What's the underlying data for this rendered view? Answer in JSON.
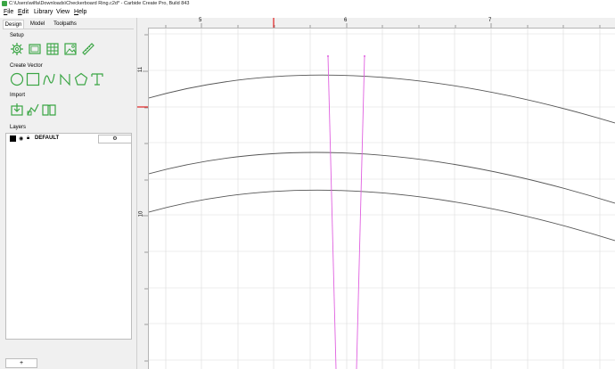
{
  "window": {
    "title": "C:\\Users\\wilfa\\Downloads\\Checkerboard Ring.c2d* - Carbide Create Pro, Build 843"
  },
  "menu": [
    {
      "label": "File",
      "u": "F",
      "rest": "ile"
    },
    {
      "label": "Edit",
      "u": "E",
      "rest": "dit"
    },
    {
      "label": "Library",
      "u": "",
      "rest": "Library"
    },
    {
      "label": "View",
      "u": "",
      "rest": "View"
    },
    {
      "label": "Help",
      "u": "H",
      "rest": "elp"
    }
  ],
  "tabs": [
    "Design",
    "Model",
    "Toolpaths"
  ],
  "active_tab": "Design",
  "sections": {
    "setup": "Setup",
    "create_vector": "Create Vector",
    "import": "Import",
    "layers": "Layers"
  },
  "tool_icons": {
    "setup": [
      "gear-icon",
      "rectangle-icon",
      "grid-icon",
      "image-icon",
      "ruler-icon"
    ],
    "create_vector": [
      "circle-icon",
      "square-icon",
      "curve-icon",
      "polyline-icon",
      "pentagon-icon",
      "text-icon"
    ],
    "import": [
      "import-icon",
      "import-svg-icon",
      "library-book-icon"
    ]
  },
  "layers": [
    {
      "name": "DEFAULT",
      "color": "#000000"
    }
  ],
  "add_layer_label": "+",
  "ruler": {
    "top": [
      "5",
      "6",
      "7"
    ],
    "left": [
      "11",
      "10"
    ]
  },
  "colors": {
    "accent": "#3aa544",
    "selection": "#e040e0",
    "ruler_marker": "#e02020",
    "curves": "#555555"
  }
}
